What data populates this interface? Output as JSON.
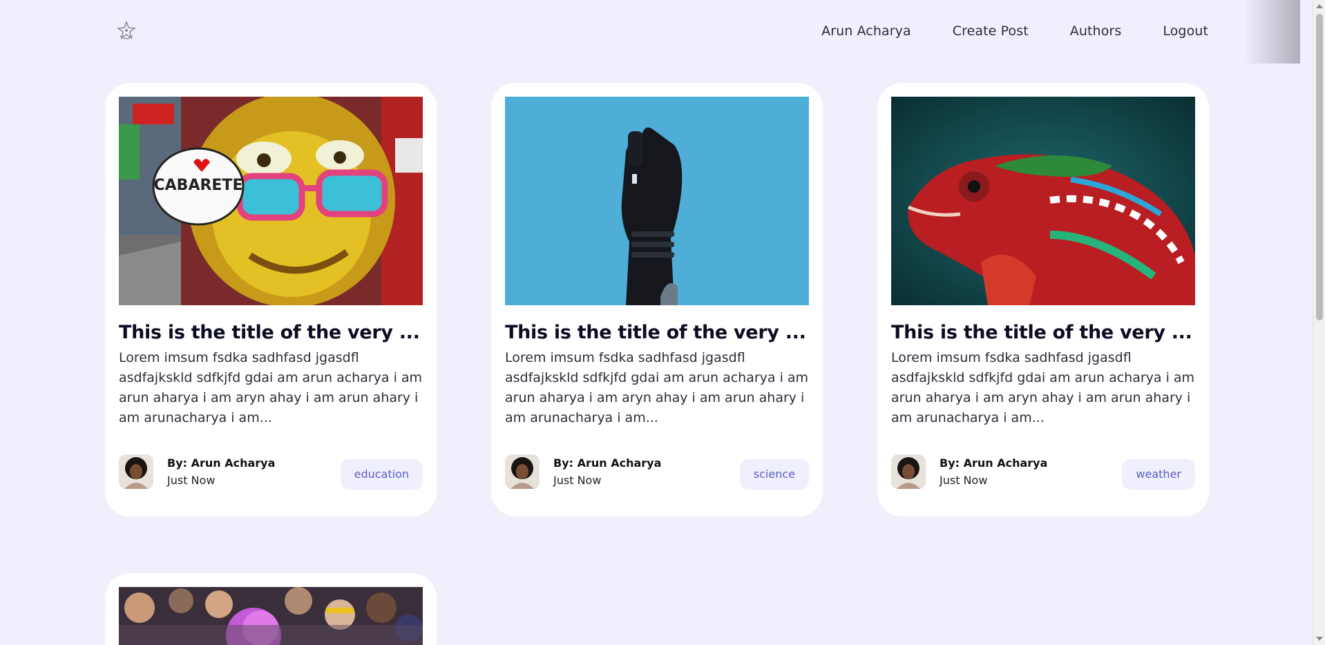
{
  "nav": {
    "links": [
      "Arun Acharya",
      "Create Post",
      "Authors",
      "Logout"
    ]
  },
  "icons": {
    "logo": "logo-icon"
  },
  "colors": {
    "background": "#f0f0fd",
    "card": "#ffffff",
    "tag_bg": "#efeffd",
    "tag_text": "#5b5fc7"
  },
  "posts": [
    {
      "title": "This is the title of the very ...",
      "excerpt": "Lorem imsum fsdka sadhfasd jgasdfl asdfajkskld sdfkjfd gdai am arun acharya i am arun aharya i am aryn ahay i am arun ahary i am arunacharya i am...",
      "author": "By: Arun Acharya",
      "time": "Just Now",
      "category": "education",
      "image": "graffiti-monkey-image"
    },
    {
      "title": "This is the title of the very ...",
      "excerpt": "Lorem imsum fsdka sadhfasd jgasdfl asdfajkskld sdfkjfd gdai am arun acharya i am arun aharya i am aryn ahay i am arun ahary i am arunacharya i am...",
      "author": "By: Arun Acharya",
      "time": "Just Now",
      "category": "science",
      "image": "robot-hand-image"
    },
    {
      "title": "This is the title of the very ...",
      "excerpt": "Lorem imsum fsdka sadhfasd jgasdfl asdfajkskld sdfkjfd gdai am arun acharya i am arun aharya i am aryn ahay i am arun ahary i am arunacharya i am...",
      "author": "By: Arun Acharya",
      "time": "Just Now",
      "category": "weather",
      "image": "chameleon-image"
    },
    {
      "image": "crowd-party-image"
    }
  ]
}
